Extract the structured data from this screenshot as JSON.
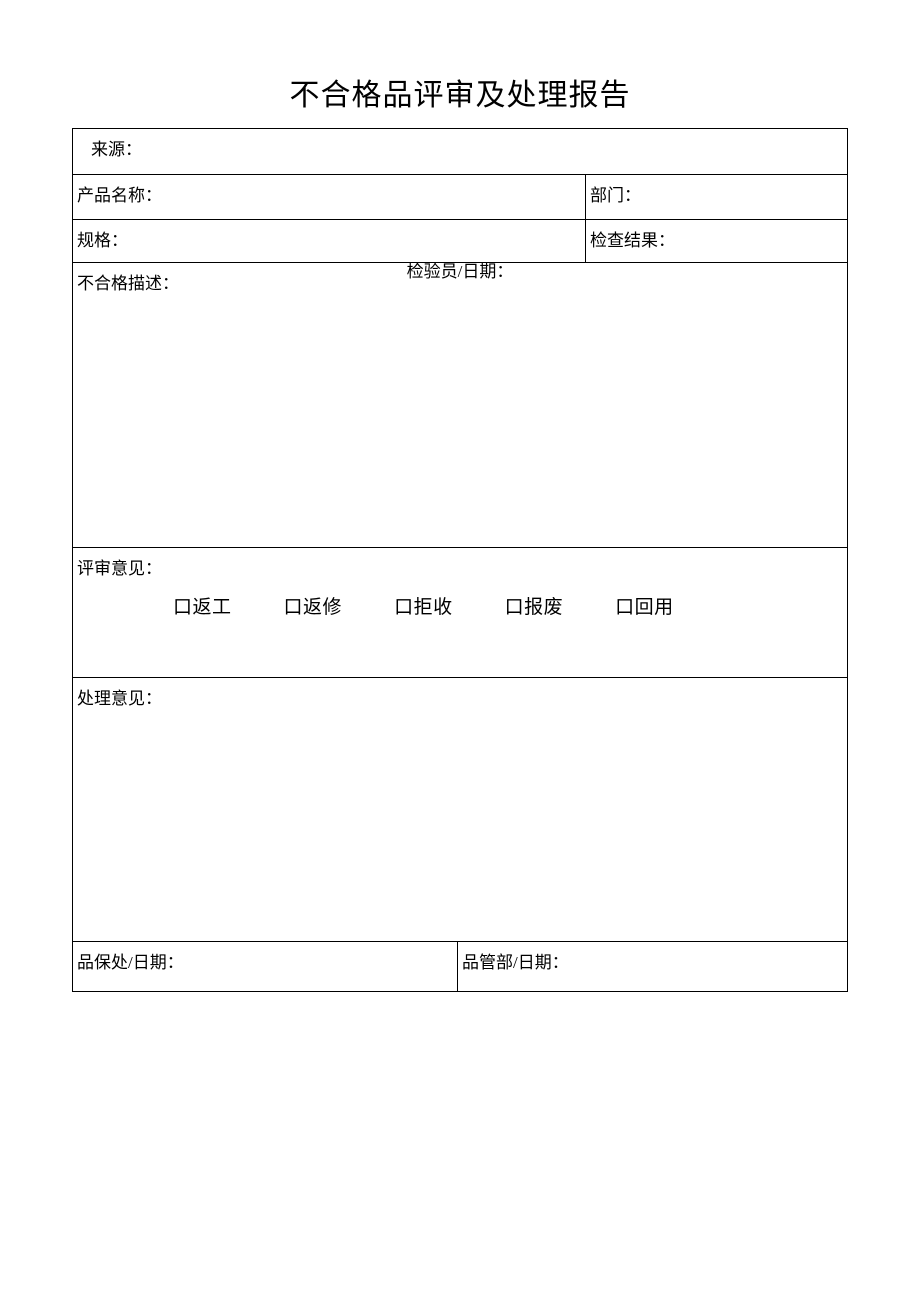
{
  "document": {
    "title": "不合格品评审及处理报告"
  },
  "form": {
    "source": {
      "label": "来源："
    },
    "product_name": {
      "label": "产品名称："
    },
    "department": {
      "label": "部门："
    },
    "specification": {
      "label": "规格："
    },
    "inspection_result": {
      "label": "检查结果："
    },
    "nonconformity_description": {
      "label": "不合格描述：",
      "inspector_date_label": "检验员/日期："
    },
    "review_opinion": {
      "label": "评审意见：",
      "options": [
        {
          "box": "口",
          "label": "返工"
        },
        {
          "box": "口",
          "label": "返修"
        },
        {
          "box": "口",
          "label": "拒收"
        },
        {
          "box": "口",
          "label": "报废"
        },
        {
          "box": "口",
          "label": "回用"
        }
      ]
    },
    "disposition_opinion": {
      "label": "处理意见："
    },
    "signatures": {
      "quality_assurance": {
        "label": "品保处/日期："
      },
      "quality_control": {
        "label": "品管部/日期："
      }
    }
  }
}
